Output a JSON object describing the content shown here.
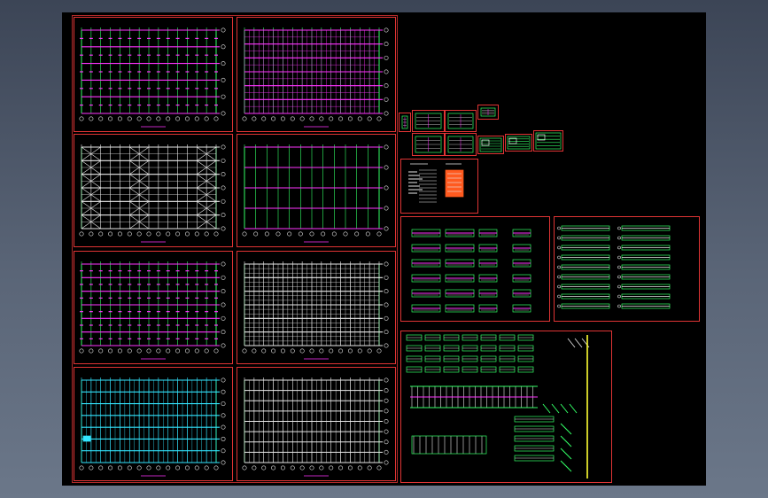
{
  "viewer": {
    "background_color": "#000000",
    "frame_color": "#e03434",
    "line_colors": {
      "beam": "#ff33ff",
      "grid": "#33ff66",
      "white": "#e8e8e8",
      "cyan": "#33e6ff",
      "orange": "#ff5a1f",
      "yellow": "#ffff33"
    }
  },
  "sheets": [
    {
      "id": "s1",
      "kind": "plan-magenta",
      "group": "left-column"
    },
    {
      "id": "s2",
      "kind": "plan-magenta-dense",
      "group": "left-column"
    },
    {
      "id": "s3",
      "kind": "plan-white-braced",
      "group": "left-column"
    },
    {
      "id": "s4",
      "kind": "plan-magenta-sparse",
      "group": "left-column"
    },
    {
      "id": "s5",
      "kind": "plan-magenta-labels",
      "group": "left-column"
    },
    {
      "id": "s6",
      "kind": "plan-white-dense",
      "group": "left-column"
    },
    {
      "id": "s7",
      "kind": "plan-cyan",
      "group": "left-column"
    },
    {
      "id": "s8",
      "kind": "plan-white-grid",
      "group": "left-column"
    },
    {
      "id": "t1",
      "kind": "thumbnail-details",
      "group": "top-small"
    },
    {
      "id": "t2",
      "kind": "notes-sheet",
      "group": "top-small"
    },
    {
      "id": "d1",
      "kind": "beam-details",
      "group": "right-details"
    },
    {
      "id": "d2",
      "kind": "beam-details",
      "group": "right-details"
    },
    {
      "id": "d3",
      "kind": "section-details",
      "group": "right-details"
    }
  ]
}
